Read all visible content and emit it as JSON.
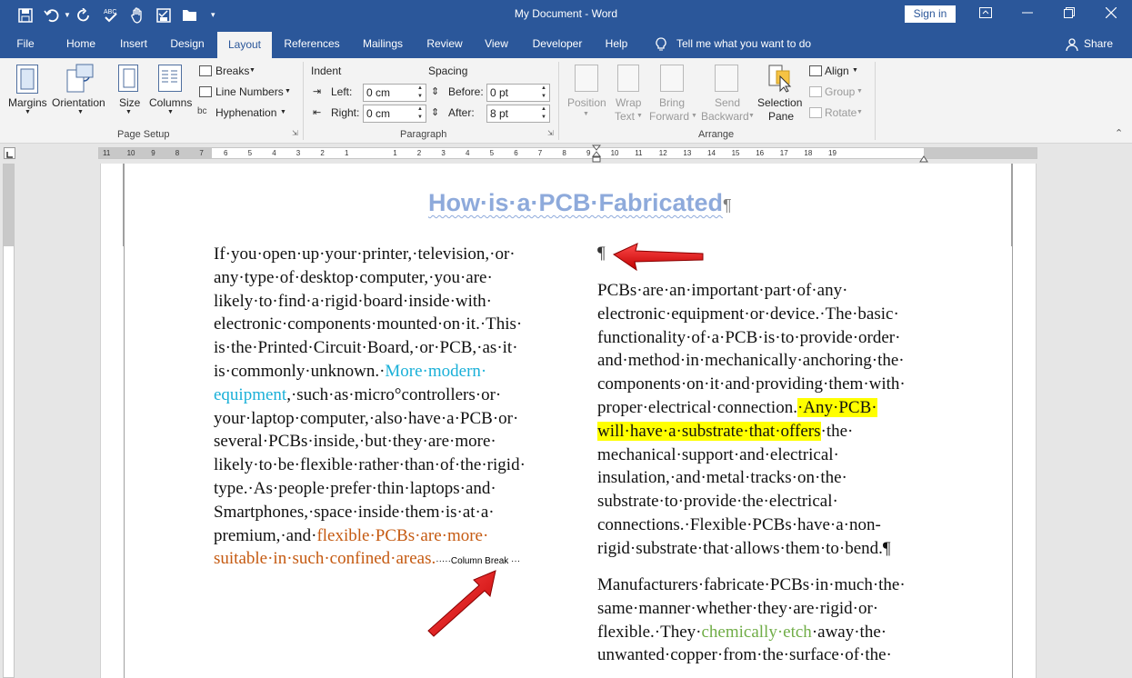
{
  "window": {
    "title": "My Document  -  Word",
    "sign_in": "Sign in"
  },
  "tabs": [
    "File",
    "Home",
    "Insert",
    "Design",
    "Layout",
    "References",
    "Mailings",
    "Review",
    "View",
    "Developer",
    "Help"
  ],
  "active_tab": "Layout",
  "tell_me": "Tell me what you want to do",
  "share": "Share",
  "ribbon": {
    "page_setup": {
      "group_label": "Page Setup",
      "margins": "Margins",
      "orientation": "Orientation",
      "size": "Size",
      "columns": "Columns",
      "breaks": "Breaks",
      "line_numbers": "Line Numbers",
      "hyphenation": "Hyphenation"
    },
    "paragraph": {
      "group_label": "Paragraph",
      "indent_label": "Indent",
      "spacing_label": "Spacing",
      "left_label": "Left:",
      "left_value": "0 cm",
      "right_label": "Right:",
      "right_value": "0 cm",
      "before_label": "Before:",
      "before_value": "0 pt",
      "after_label": "After:",
      "after_value": "8 pt"
    },
    "arrange": {
      "group_label": "Arrange",
      "position": "Position",
      "wrap_text_1": "Wrap",
      "wrap_text_2": "Text",
      "bring_forward_1": "Bring",
      "bring_forward_2": "Forward",
      "send_backward_1": "Send",
      "send_backward_2": "Backward",
      "selection_pane_1": "Selection",
      "selection_pane_2": "Pane",
      "align": "Align",
      "group": "Group",
      "rotate": "Rotate"
    }
  },
  "ruler_ticks": [
    "11",
    "10",
    "9",
    "8",
    "7",
    "6",
    "5",
    "4",
    "3",
    "2",
    "1",
    "1",
    "2",
    "3",
    "4",
    "5",
    "6",
    "7",
    "8",
    "9",
    "10",
    "11",
    "12",
    "13",
    "14",
    "15",
    "16",
    "17",
    "18",
    "19"
  ],
  "document": {
    "title": "How·is·a·PCB·Fabricated",
    "pilcrow": "¶",
    "left_column": {
      "lines": [
        "If·you·open·up·your·printer,·television,·or·",
        "any·type·of·desktop·computer,·you·are·",
        "likely·to·find·a·rigid·board·inside·with·",
        "electronic·components·mounted·on·it.·This·",
        "is·the·Printed·Circuit·Board,·or·PCB,·as·it·"
      ],
      "line6_a": "is·commonly·unknown.·",
      "line6_b": "More·modern·",
      "line7_a": "equipment",
      "line7_b": ",·such·as·micro°controllers·or·",
      "lines2": [
        "your·laptop·computer,·also·have·a·PCB·or·",
        "several·PCBs·inside,·but·they·are·more·",
        "likely·to·be·flexible·rather·than·of·the·rigid·",
        "type.·As·people·prefer·thin·laptops·and·",
        "Smartphones,·space·inside·them·is·at·a·"
      ],
      "line13_a": "premium,·and·",
      "line13_b": "flexible·PCBs·are·more·",
      "line14": "suitable·in·such·confined·areas.",
      "column_break": "·····Column Break ···"
    },
    "right_column": {
      "p1_lines": [
        "PCBs·are·an·important·part·of·any·",
        "electronic·equipment·or·device.·The·basic·",
        "functionality·of·a·PCB·is·to·provide·order·",
        "and·method·in·mechanically·anchoring·the·",
        "components·on·it·and·providing·them·with·"
      ],
      "p1_l6_a": "proper·electrical·connection.",
      "p1_l6_b": "·Any·PCB·",
      "p1_l7_a": "will·have·a·substrate·that·offers",
      "p1_l7_b": "·the·",
      "p1_lines2": [
        "mechanical·support·and·electrical·",
        "insulation,·and·metal·tracks·on·the·",
        "substrate·to·provide·the·electrical·",
        "connections.·Flexible·PCBs·have·a·non-"
      ],
      "p1_last": "rigid·substrate·that·allows·them·to·bend.¶",
      "p2_lines": [
        "Manufacturers·fabricate·PCBs·in·much·the·",
        "same·manner·whether·they·are·rigid·or·"
      ],
      "p2_l3_a": "flexible.·They·",
      "p2_l3_b": "chemically·etch",
      "p2_l3_c": "·away·the·",
      "p2_l4": "unwanted·copper·from·the·surface·of·the·"
    }
  }
}
